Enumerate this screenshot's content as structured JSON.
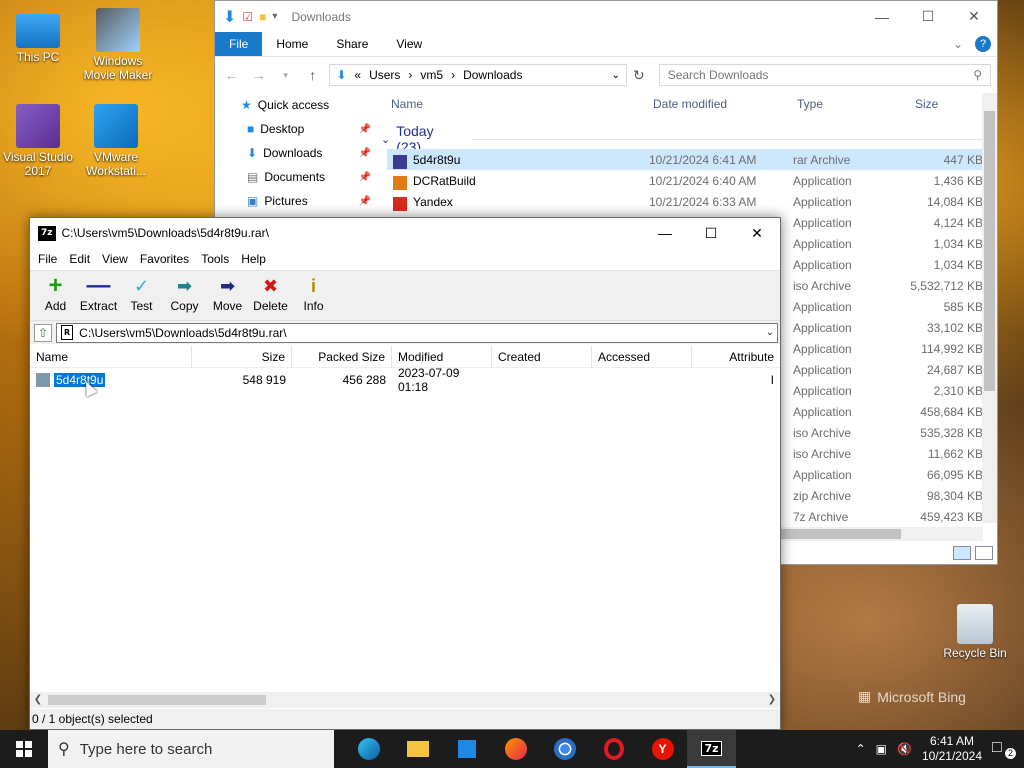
{
  "desktop": {
    "icons": [
      {
        "label": "This PC"
      },
      {
        "label": "Windows\nMovie Maker"
      },
      {
        "label": "Visual Studio\n2017"
      },
      {
        "label": "VMware\nWorkstati..."
      },
      {
        "label": "Recycle Bin"
      }
    ],
    "watermark": "Microsoft Bing"
  },
  "explorer": {
    "title": "Downloads",
    "ribbon_tabs": [
      "File",
      "Home",
      "Share",
      "View"
    ],
    "breadcrumb": [
      "Users",
      "vm5",
      "Downloads"
    ],
    "search_placeholder": "Search Downloads",
    "nav": [
      {
        "label": "Quick access"
      },
      {
        "label": "Desktop"
      },
      {
        "label": "Downloads"
      },
      {
        "label": "Documents"
      },
      {
        "label": "Pictures"
      }
    ],
    "columns": [
      "Name",
      "Date modified",
      "Type",
      "Size"
    ],
    "group_label": "Today (23)",
    "rows": [
      {
        "name": "5d4r8t9u",
        "date": "10/21/2024 6:41 AM",
        "type": "rar Archive",
        "size": "447 KB"
      },
      {
        "name": "DCRatBuild",
        "date": "10/21/2024 6:40 AM",
        "type": "Application",
        "size": "1,436 KB"
      },
      {
        "name": "Yandex",
        "date": "10/21/2024 6:33 AM",
        "type": "Application",
        "size": "14,084 KB"
      },
      {
        "name": "",
        "date": "",
        "type": "Application",
        "size": "4,124 KB"
      },
      {
        "name": "",
        "date": "",
        "type": "Application",
        "size": "1,034 KB"
      },
      {
        "name": "",
        "date": "",
        "type": "Application",
        "size": "1,034 KB"
      },
      {
        "name": "",
        "date": "",
        "type": "iso Archive",
        "size": "5,532,712 KB"
      },
      {
        "name": "",
        "date": "",
        "type": "Application",
        "size": "585 KB"
      },
      {
        "name": "",
        "date": "",
        "type": "Application",
        "size": "33,102 KB"
      },
      {
        "name": "",
        "date": "",
        "type": "Application",
        "size": "114,992 KB"
      },
      {
        "name": "",
        "date": "",
        "type": "Application",
        "size": "24,687 KB"
      },
      {
        "name": "",
        "date": "",
        "type": "Application",
        "size": "2,310 KB"
      },
      {
        "name": "",
        "date": "",
        "type": "Application",
        "size": "458,684 KB"
      },
      {
        "name": "",
        "date": "",
        "type": "iso Archive",
        "size": "535,328 KB"
      },
      {
        "name": "",
        "date": "",
        "type": "iso Archive",
        "size": "11,662 KB"
      },
      {
        "name": "",
        "date": "",
        "type": "Application",
        "size": "66,095 KB"
      },
      {
        "name": "",
        "date": "",
        "type": "zip Archive",
        "size": "98,304 KB"
      },
      {
        "name": "",
        "date": "",
        "type": "7z Archive",
        "size": "459,423 KB"
      }
    ]
  },
  "sevenzip": {
    "title": "C:\\Users\\vm5\\Downloads\\5d4r8t9u.rar\\",
    "menu": [
      "File",
      "Edit",
      "View",
      "Favorites",
      "Tools",
      "Help"
    ],
    "toolbar": [
      "Add",
      "Extract",
      "Test",
      "Copy",
      "Move",
      "Delete",
      "Info"
    ],
    "path": "C:\\Users\\vm5\\Downloads\\5d4r8t9u.rar\\",
    "columns": [
      "Name",
      "Size",
      "Packed Size",
      "Modified",
      "Created",
      "Accessed",
      "Attribute"
    ],
    "row": {
      "name": "5d4r8t9u",
      "size": "548 919",
      "packed": "456 288",
      "modified": "2023-07-09 01:18",
      "created": "",
      "accessed": "",
      "attr": "I"
    },
    "status": "0 / 1 object(s) selected"
  },
  "taskbar": {
    "search_placeholder": "Type here to search",
    "time": "6:41 AM",
    "date": "10/21/2024",
    "notification_count": "2",
    "apps": [
      "edge-icon",
      "file-explorer-icon",
      "store-icon",
      "firefox-icon",
      "chrome-icon",
      "opera-icon",
      "yandex-icon",
      "7zip-icon"
    ]
  }
}
